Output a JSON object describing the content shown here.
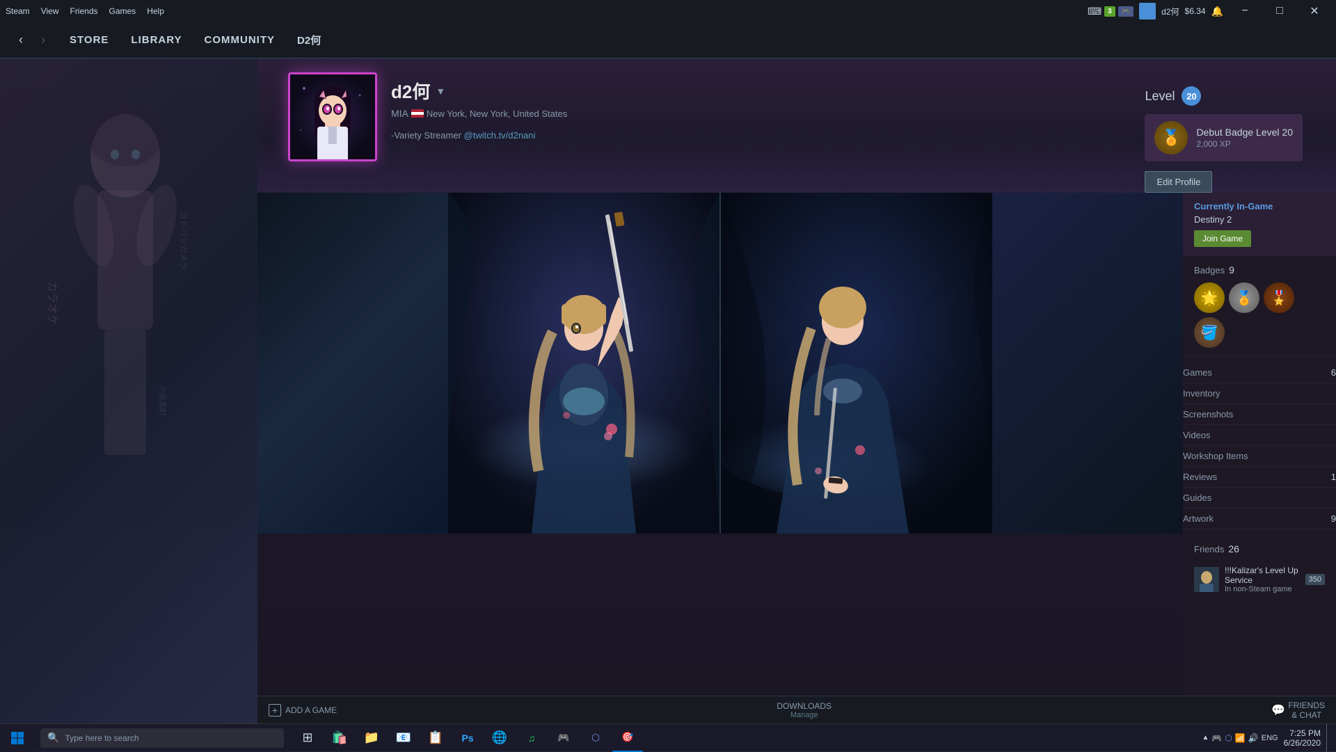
{
  "titlebar": {
    "menu_items": [
      "Steam",
      "View",
      "Friends",
      "Games",
      "Help"
    ],
    "user_name": "d2何",
    "user_balance": "$6.34",
    "time": "7:25 PM",
    "date": "6/26/2020",
    "minimize_label": "−",
    "maximize_label": "□",
    "close_label": "✕",
    "badge_3": "3",
    "notifications_icon": "🔔",
    "keyboard_icon": "⌨"
  },
  "nav": {
    "back_arrow": "‹",
    "forward_arrow": "›",
    "store_label": "STORE",
    "library_label": "LIBRARY",
    "community_label": "COMMUNITY",
    "username_label": "D2何"
  },
  "profile": {
    "name": "d2何",
    "dropdown_arrow": "▼",
    "location_flag": "🇺🇸",
    "location_text": "New York, New York, United States",
    "bio_prefix": "-Variety Streamer",
    "bio_link": "@twitch.tv/d2nani",
    "level_label": "Level",
    "level_value": "20",
    "badge_name": "Debut Badge Level 20",
    "badge_xp": "2,000 XP",
    "edit_profile_label": "Edit Profile"
  },
  "sidebar": {
    "currently_in_game_label": "Currently In-Game",
    "game_name": "Destiny 2",
    "join_game_label": "Join Game",
    "badges_label": "Badges",
    "badges_count": "9",
    "games_label": "Games",
    "games_count": "6",
    "inventory_label": "Inventory",
    "screenshots_label": "Screenshots",
    "videos_label": "Videos",
    "workshop_items_label": "Workshop Items",
    "reviews_label": "Reviews",
    "reviews_count": "1",
    "guides_label": "Guides",
    "artwork_label": "Artwork",
    "artwork_count": "9",
    "friends_label": "Friends",
    "friends_count": "26",
    "friend_name": "!!!Kalizar's Level Up Service",
    "friend_status": "In non-Steam game",
    "friend_score": "350"
  },
  "bottom_bar": {
    "add_game_label": "ADD A GAME",
    "downloads_label": "DOWNLOADS",
    "manage_label": "Manage",
    "friends_chat_label": "FRIENDS",
    "chat_label": "& CHAT"
  },
  "taskbar": {
    "search_placeholder": "Type here to search",
    "time": "7:25 PM",
    "date": "6/26/2020",
    "eng_label": "ENG"
  }
}
